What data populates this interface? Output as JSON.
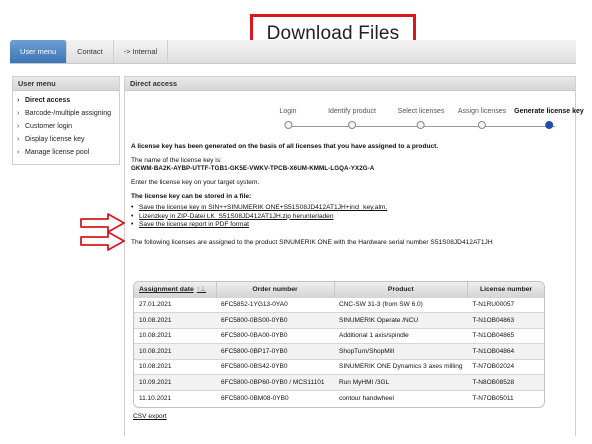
{
  "callout": {
    "text": "Download Files"
  },
  "topnav": {
    "tabs": [
      {
        "label": "User menu",
        "active": true
      },
      {
        "label": "Contact",
        "active": false
      },
      {
        "label": "-> Internal",
        "active": false
      }
    ]
  },
  "sidebar": {
    "title": "User menu",
    "items": [
      {
        "label": "Direct access",
        "active": true
      },
      {
        "label": "Barcode-/multiple assigning",
        "active": false
      },
      {
        "label": "Customer login",
        "active": false
      },
      {
        "label": "Display license key",
        "active": false
      },
      {
        "label": "Manage license pool",
        "active": false
      }
    ]
  },
  "main": {
    "title": "Direct access",
    "steps": [
      {
        "label": "Login",
        "current": false
      },
      {
        "label": "Identify product",
        "current": false
      },
      {
        "label": "Select licenses",
        "current": false
      },
      {
        "label": "Assign licenses",
        "current": false
      },
      {
        "label": "Generate license key",
        "current": true
      }
    ],
    "generated_msg": "A license key has been generated on the basis of all licenses that you have assigned to a product.",
    "key_name_label": "The name of the license key is:",
    "key_name": "GKWM-BA2K-AYBP-UTTF-TGB1-GK5E-VWKV-TPCB-X6UM-KMML-LGQA-YX2G-A",
    "enter_msg": "Enter the license key on your target system.",
    "stored_heading": "The license key can be stored in a file:",
    "links": [
      "Save the license key in SIN++SINUMERIK ONE+S51S08JD412AT1JH+incl_key.alm.",
      "Lizenzkey in ZIP-Datei LK_S51S08JD412AT1JH.zip herunterladen",
      "Save the license report in PDF format"
    ],
    "assigned_msg": "The following licenses are assigned to the product SINUMERIK ONE with the Hardware serial number S51S08JD412AT1JH",
    "table": {
      "headers": [
        "Assignment date",
        "Order number",
        "Product",
        "License number"
      ],
      "sort_indicator": "↑⊥",
      "rows": [
        [
          "27.01.2021",
          "6FC5852-1YG13-0YA0",
          "CNC-SW 31-3 (from SW 6.0)",
          "T-N1RU00057"
        ],
        [
          "10.08.2021",
          "6FC5800-0BS00-0YB0",
          "SINUMERIK Operate /NCU",
          "T-N1OB04863"
        ],
        [
          "10.08.2021",
          "6FC5800-0BA00-0YB0",
          "Additional 1 axis/spindle",
          "T-N1OB04865"
        ],
        [
          "10.08.2021",
          "6FC5800-0BP17-0YB0",
          "ShopTurn/ShopMill",
          "T-N1OB04864"
        ],
        [
          "10.08.2021",
          "6FC5800-0BS42-0YB0",
          "SINUMERIK ONE Dynamics 3 axes milling",
          "T-N7OB02024"
        ],
        [
          "10.09.2021",
          "6FC5800-0BP60-0YB0 / MCS11101",
          "Run MyHMI /3GL",
          "T-N8OB08528"
        ],
        [
          "11.10.2021",
          "6FC5800-0BM08-0YB0",
          "contour handwheel",
          "T-N7OB05011"
        ]
      ]
    },
    "csv_export": "CSV export"
  },
  "colors": {
    "callout_border": "#d7191f",
    "active_tab": "#3c75b6",
    "current_step": "#1f4fa8"
  }
}
